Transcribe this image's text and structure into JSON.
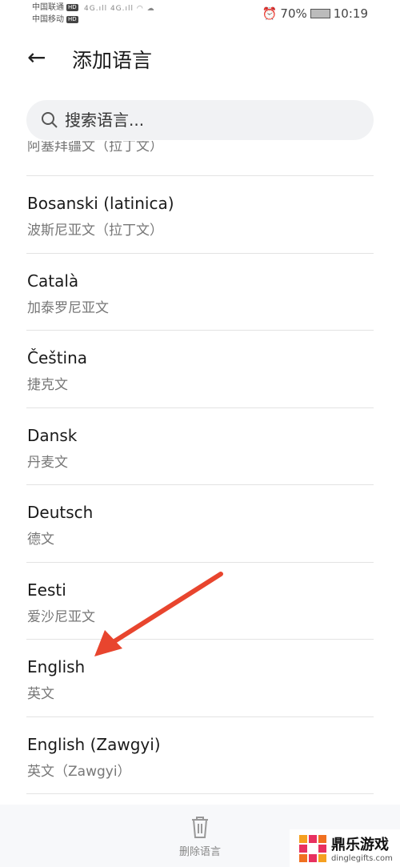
{
  "status": {
    "carrier1": "中国联通",
    "carrier2": "中国移动",
    "hd": "HD",
    "net1": "4G",
    "net2": "4G",
    "battery": "70%",
    "time": "10:19"
  },
  "header": {
    "title": "添加语言"
  },
  "search": {
    "placeholder": "搜索语言..."
  },
  "clipped_item": "阿塞拜疆文（拉丁文）",
  "languages": [
    {
      "name": "Bosanski (latinica)",
      "sub": "波斯尼亚文（拉丁文）"
    },
    {
      "name": "Català",
      "sub": "加泰罗尼亚文"
    },
    {
      "name": "Čeština",
      "sub": "捷克文"
    },
    {
      "name": "Dansk",
      "sub": "丹麦文"
    },
    {
      "name": "Deutsch",
      "sub": "德文"
    },
    {
      "name": "Eesti",
      "sub": "爱沙尼亚文"
    },
    {
      "name": "English",
      "sub": "英文"
    },
    {
      "name": "English (Zawgyi)",
      "sub": "英文（Zawgyi）"
    }
  ],
  "bottom": {
    "delete_label": "删除语言"
  },
  "watermark": {
    "name": "鼎乐游戏",
    "url": "dinglegifts.com"
  },
  "colors": {
    "arrow": "#e8452e"
  }
}
